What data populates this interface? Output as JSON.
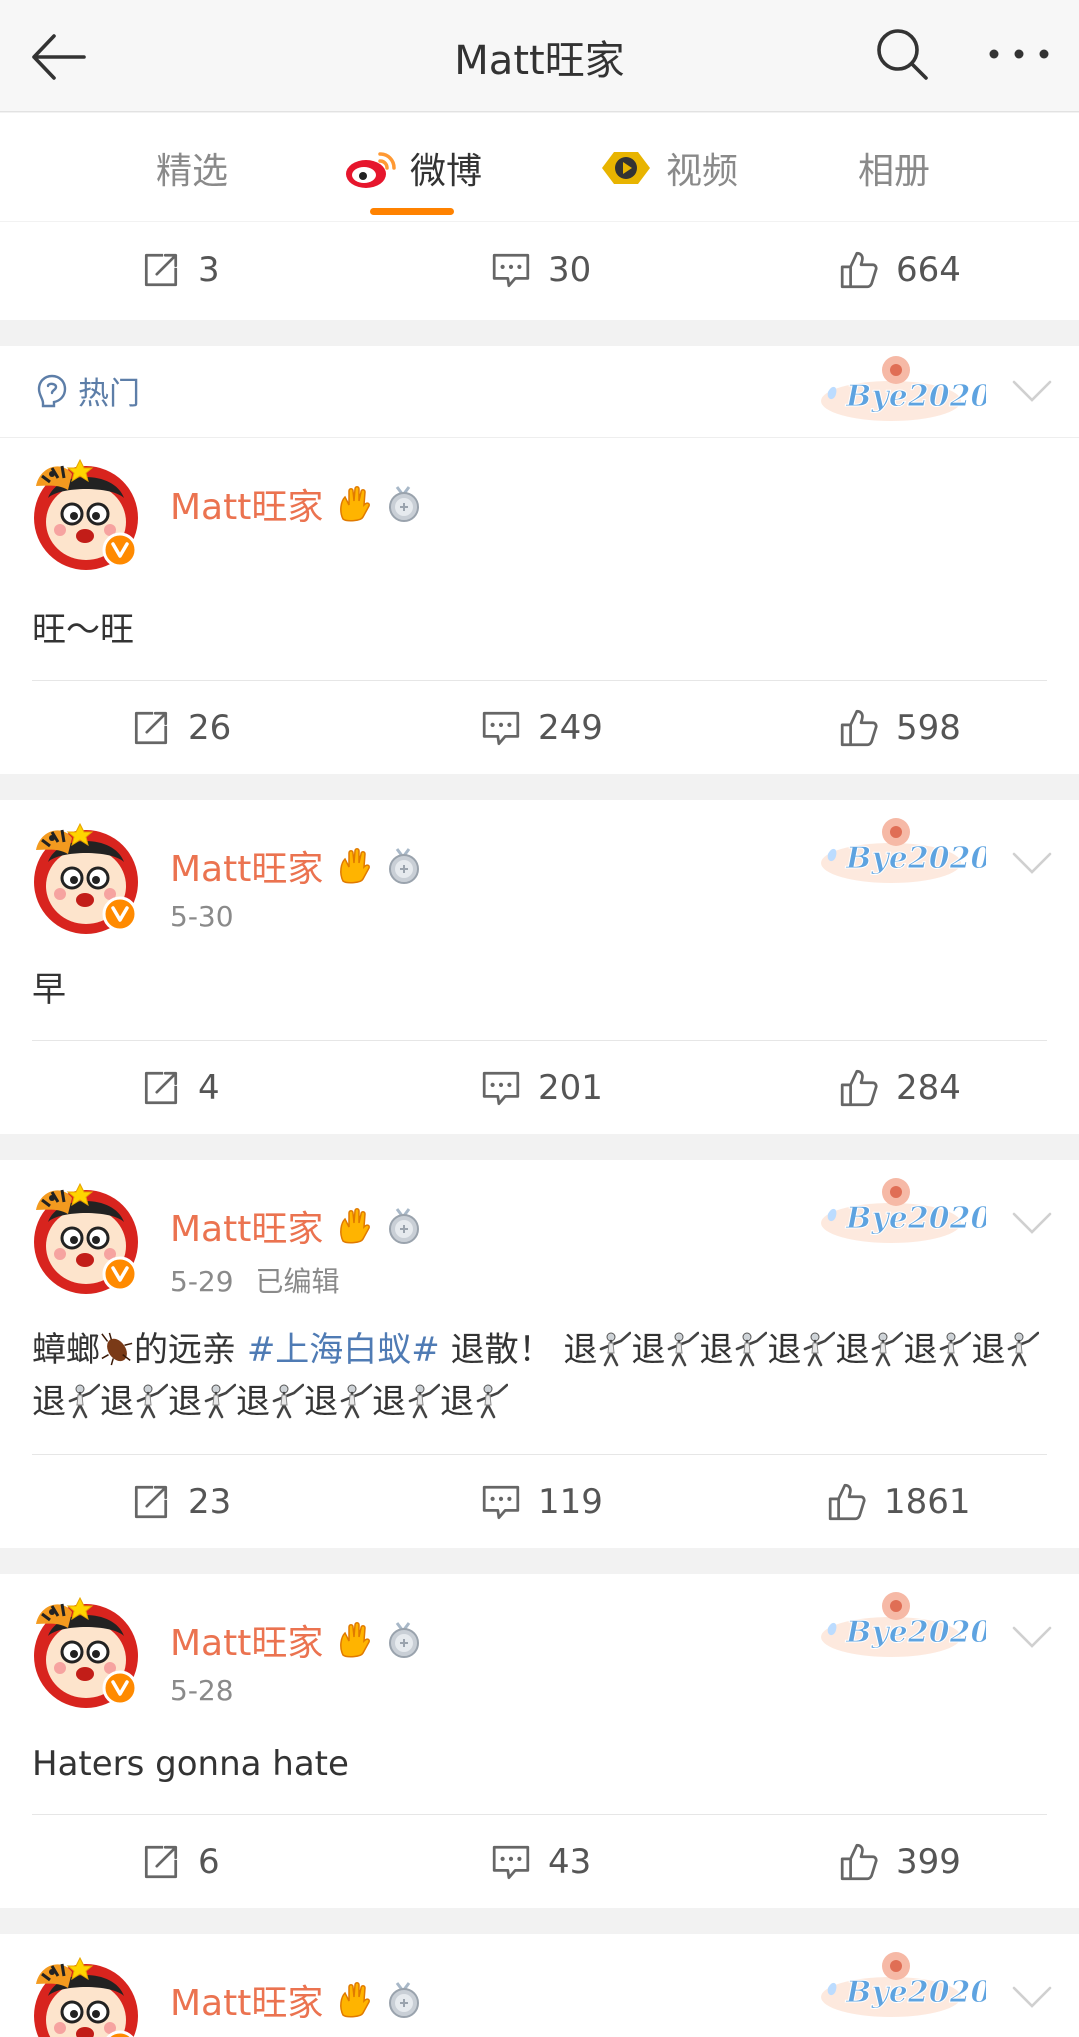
{
  "header": {
    "title": "Matt旺家"
  },
  "tabs": [
    {
      "label": "精选"
    },
    {
      "label": "微博"
    },
    {
      "label": "视频"
    },
    {
      "label": "相册"
    }
  ],
  "colors": {
    "accent": "#ff8200",
    "username": "#eb7350",
    "topic": "#4f7bb4",
    "hot": "#5d7ea8"
  },
  "stamp_text": "Bye2020",
  "prev_post": {
    "repost": "3",
    "comment": "30",
    "like": "664"
  },
  "hot_section": {
    "label": "热门"
  },
  "posts": [
    {
      "user": "Matt旺家",
      "date": "",
      "edited": "",
      "text": "旺～旺",
      "repost": "26",
      "comment": "249",
      "like": "598"
    },
    {
      "user": "Matt旺家",
      "date": "5-30",
      "edited": "",
      "text": "早",
      "repost": "4",
      "comment": "201",
      "like": "284"
    },
    {
      "user": "Matt旺家",
      "date": "5-29",
      "edited": "已编辑",
      "text_parts": {
        "before": "蟑螂",
        "mid": "的远亲 ",
        "topic": "#上海白蚁#",
        "after": " 退散！",
        "retreat": "退"
      },
      "repost": "23",
      "comment": "119",
      "like": "1861"
    },
    {
      "user": "Matt旺家",
      "date": "5-28",
      "edited": "",
      "text": "Haters gonna hate",
      "repost": "6",
      "comment": "43",
      "like": "399"
    },
    {
      "user": "Matt旺家"
    }
  ]
}
